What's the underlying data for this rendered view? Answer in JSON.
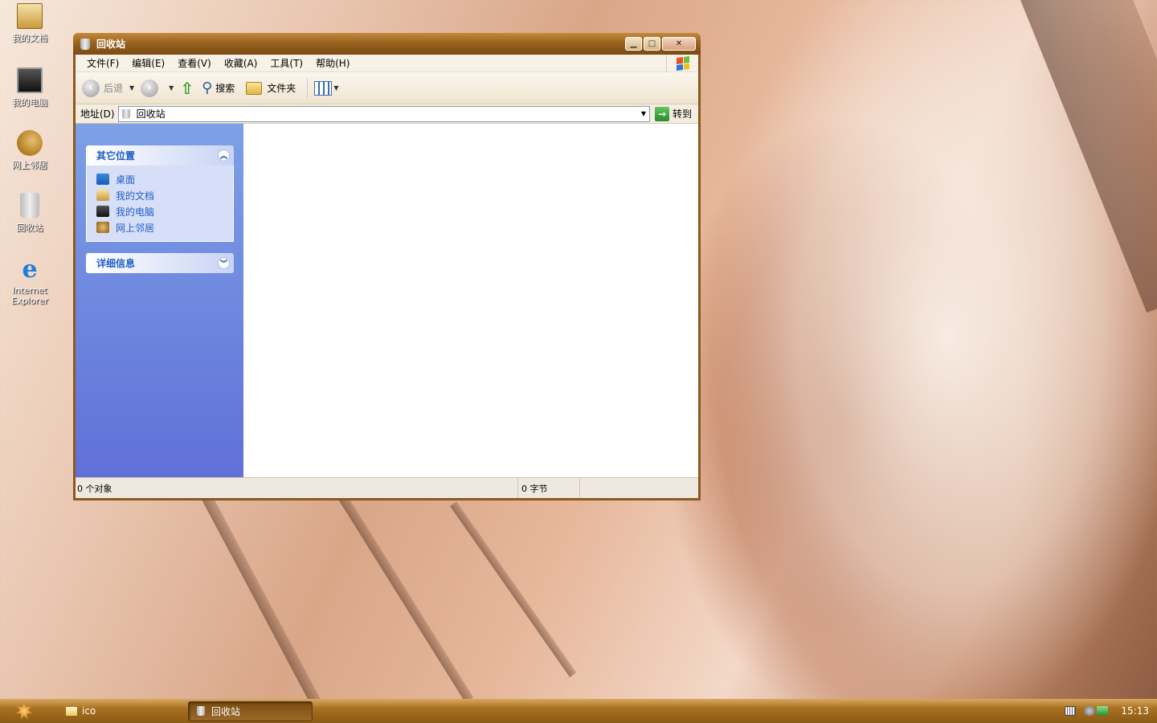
{
  "desktop": {
    "icons": [
      {
        "label": "我的文档",
        "icon": "my-documents-icon"
      },
      {
        "label": "我的电脑",
        "icon": "my-computer-icon"
      },
      {
        "label": "网上邻居",
        "icon": "network-places-icon"
      },
      {
        "label": "回收站",
        "icon": "recycle-bin-icon"
      },
      {
        "label": "Internet Explorer",
        "icon": "internet-explorer-icon"
      }
    ]
  },
  "window": {
    "title": "回收站",
    "menu": [
      "文件(F)",
      "编辑(E)",
      "查看(V)",
      "收藏(A)",
      "工具(T)",
      "帮助(H)"
    ],
    "toolbar": {
      "back_label": "后退",
      "search_label": "搜索",
      "folders_label": "文件夹"
    },
    "address": {
      "label": "地址(D)",
      "value": "回收站",
      "go_label": "转到"
    },
    "taskpane": {
      "other_places": {
        "title": "其它位置",
        "links": [
          "桌面",
          "我的文档",
          "我的电脑",
          "网上邻居"
        ]
      },
      "details": {
        "title": "详细信息"
      }
    },
    "status": {
      "objects": "0 个对象",
      "size": "0 字节"
    }
  },
  "taskbar": {
    "quick_folder": "ico",
    "active_task": "回收站",
    "clock": "15:13"
  },
  "colors": {
    "titlebar": "#9a6420",
    "taskpane": "#6f88e0",
    "link": "#215dc6",
    "taskbar": "#a87020"
  }
}
